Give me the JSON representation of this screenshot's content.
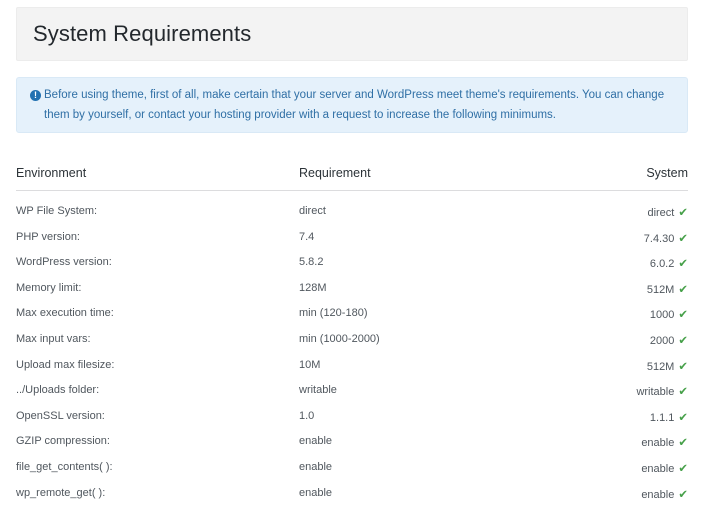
{
  "page": {
    "title": "System Requirements"
  },
  "notice": {
    "icon": "info-icon",
    "text": "Before using theme, first of all, make certain that your server and WordPress meet theme's requirements. You can change them by yourself, or contact your hosting provider with a request to increase the following minimums."
  },
  "table": {
    "headers": {
      "environment": "Environment",
      "requirement": "Requirement",
      "system": "System"
    },
    "rows": [
      {
        "environment": "WP File System:",
        "requirement": "direct",
        "system": "direct"
      },
      {
        "environment": "PHP version:",
        "requirement": "7.4",
        "system": "7.4.30"
      },
      {
        "environment": "WordPress version:",
        "requirement": "5.8.2",
        "system": "6.0.2"
      },
      {
        "environment": "Memory limit:",
        "requirement": "128M",
        "system": "512M"
      },
      {
        "environment": "Max execution time:",
        "requirement": "min (120-180)",
        "system": "1000"
      },
      {
        "environment": "Max input vars:",
        "requirement": "min (1000-2000)",
        "system": "2000"
      },
      {
        "environment": "Upload max filesize:",
        "requirement": "10M",
        "system": "512M"
      },
      {
        "environment": "../Uploads folder:",
        "requirement": "writable",
        "system": "writable"
      },
      {
        "environment": "OpenSSL version:",
        "requirement": "1.0",
        "system": "1.1.1"
      },
      {
        "environment": "GZIP compression:",
        "requirement": "enable",
        "system": "enable"
      },
      {
        "environment": "file_get_contents( ):",
        "requirement": "enable",
        "system": "enable"
      },
      {
        "environment": "wp_remote_get( ):",
        "requirement": "enable",
        "system": "enable"
      }
    ],
    "status_icon": "check-icon",
    "check_color": "#46a049"
  },
  "colors": {
    "header_bg": "#f3f3f3",
    "notice_bg": "#e5f1fb",
    "notice_text": "#2f6fa5"
  }
}
